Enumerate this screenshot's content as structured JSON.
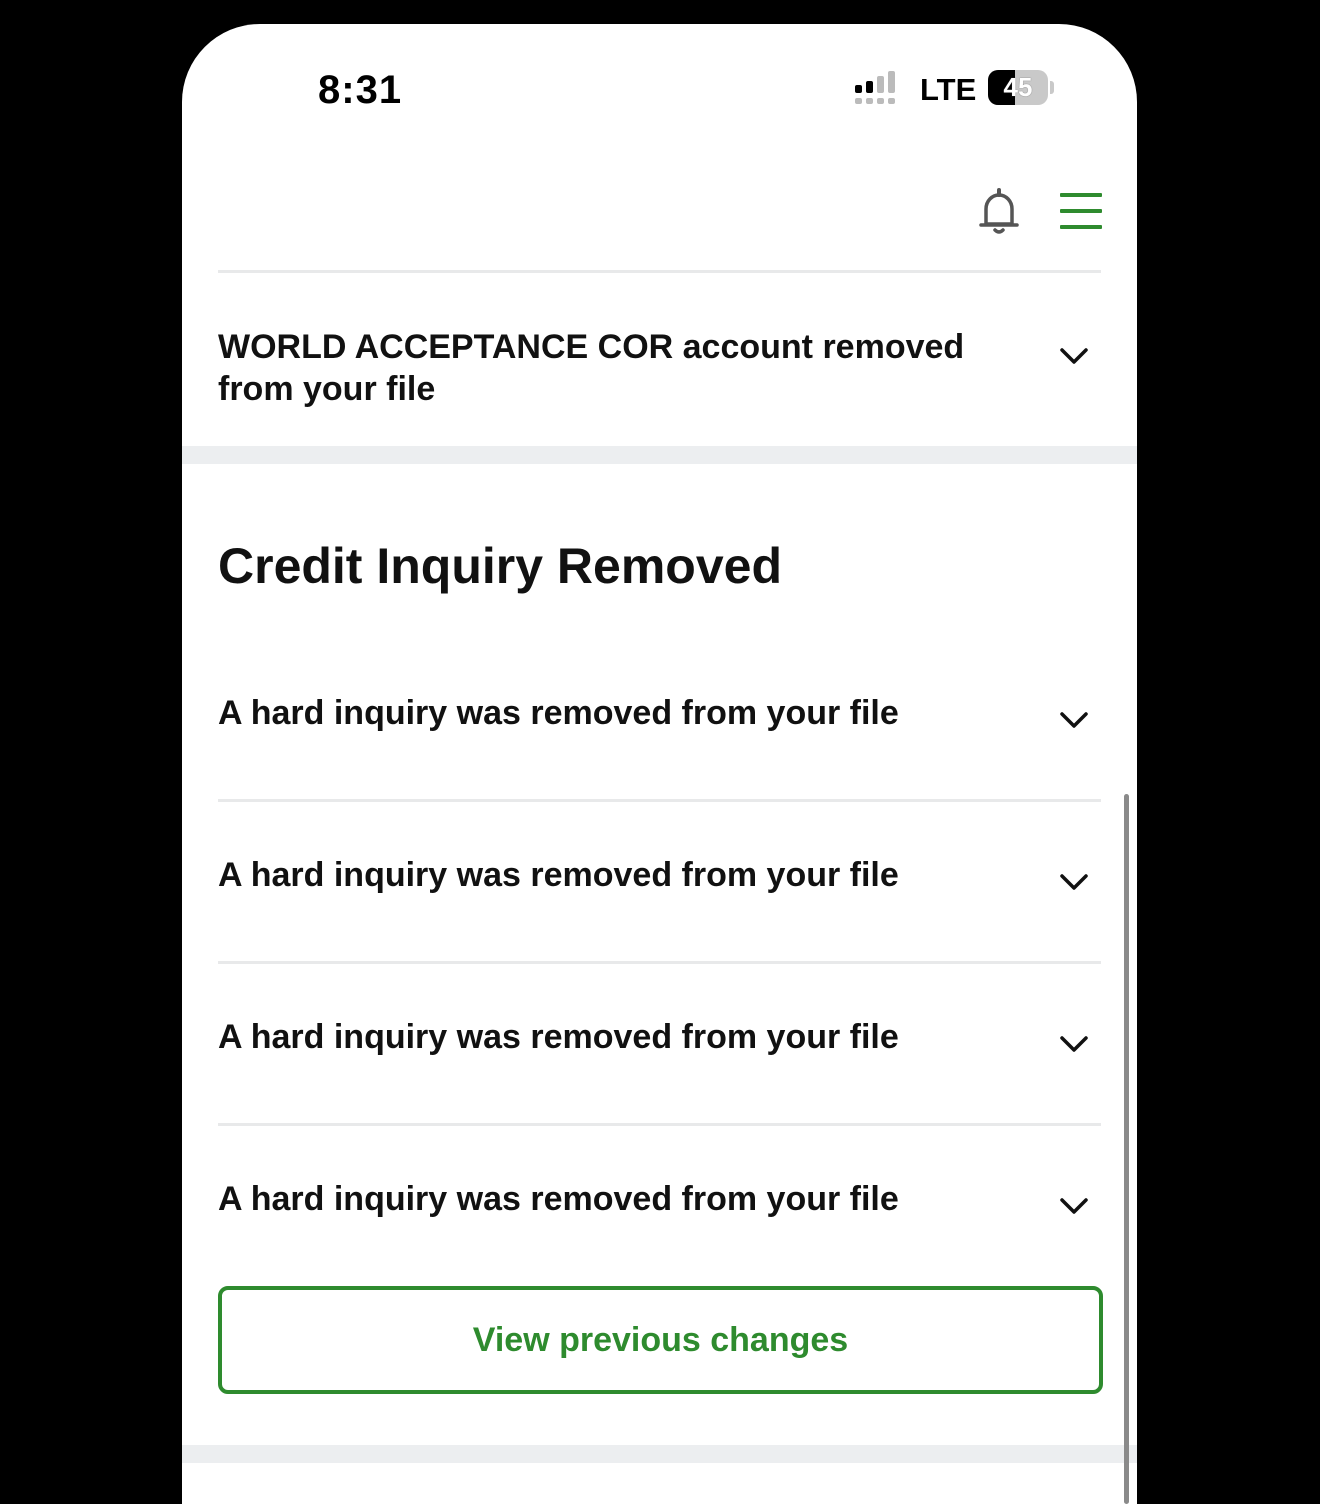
{
  "status_bar": {
    "time": "8:31",
    "network": "LTE",
    "battery_level": "45",
    "battery_fraction": 0.45,
    "signal_icon": "cellular-signal-icon"
  },
  "header": {
    "icons": [
      "bell-icon",
      "menu-icon"
    ],
    "accent_color": "#2e8b2e"
  },
  "top_item": {
    "text": "WORLD ACCEPTANCE COR account removed from your file",
    "icon": "chevron-down-icon"
  },
  "section": {
    "title": "Credit Inquiry Removed",
    "items": [
      {
        "text": "A hard inquiry was removed from your file"
      },
      {
        "text": "A hard inquiry was removed from your file"
      },
      {
        "text": "A hard inquiry was removed from your file"
      },
      {
        "text": "A hard inquiry was removed from your file"
      }
    ]
  },
  "cta": {
    "label": "View previous changes"
  }
}
